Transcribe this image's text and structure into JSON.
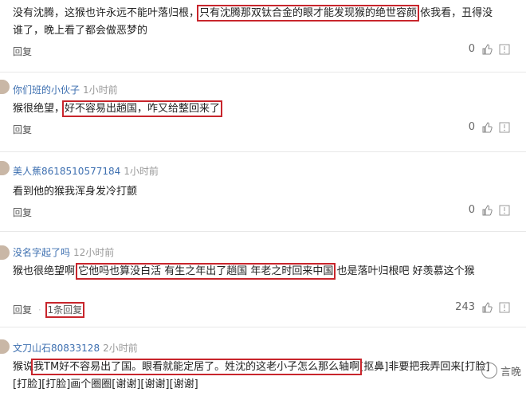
{
  "comments": [
    {
      "user": "",
      "time": "",
      "text_a": "没有沈腾，这猴也许永远不能叶落归根，",
      "text_hl": "只有沈腾那双钛合金的眼才能发现猴的绝世容颜",
      "text_b": " 依我看，丑得没谁了，晚上看了都会做恶梦的",
      "reply": "回复",
      "likes": "0"
    },
    {
      "user": "你们班的小伙子",
      "time": "1小时前",
      "text_a": "猴很绝望，",
      "text_hl": "好不容易出趟国，咋又给整回来了",
      "text_b": "",
      "reply": "回复",
      "likes": "0"
    },
    {
      "user": "美人蕉8618510577184",
      "time": "1小时前",
      "text_a": "看到他的猴我浑身发冷打颤",
      "text_hl": "",
      "text_b": "",
      "reply": "回复",
      "likes": "0"
    },
    {
      "user": "没名字起了吗",
      "time": "12小时前",
      "text_a": "猴也很绝望啊 ",
      "text_hl": "它他吗也算没白活 有生之年出了趟国 年老之时回来中国",
      "text_b": " 也是落叶归根吧 好羡慕这个猴",
      "reply": "回复",
      "reply_count": "1条回复",
      "likes": "243"
    },
    {
      "user": "文刀山石80833128",
      "time": "2小时前",
      "text_a": "猴说",
      "text_hl": "我TM好不容易出了国。眼看就能定居了。姓沈的这老小子怎么那么轴啊",
      "text_b": "[抠鼻]非要把我弄回来[打脸][打脸][打脸]画个圈圈[谢谢][谢谢][谢谢]",
      "reply": "",
      "likes": ""
    }
  ],
  "watermark": "言晚",
  "colors": {
    "username": "#3d6fb0",
    "highlight_box": "#c8252c"
  }
}
